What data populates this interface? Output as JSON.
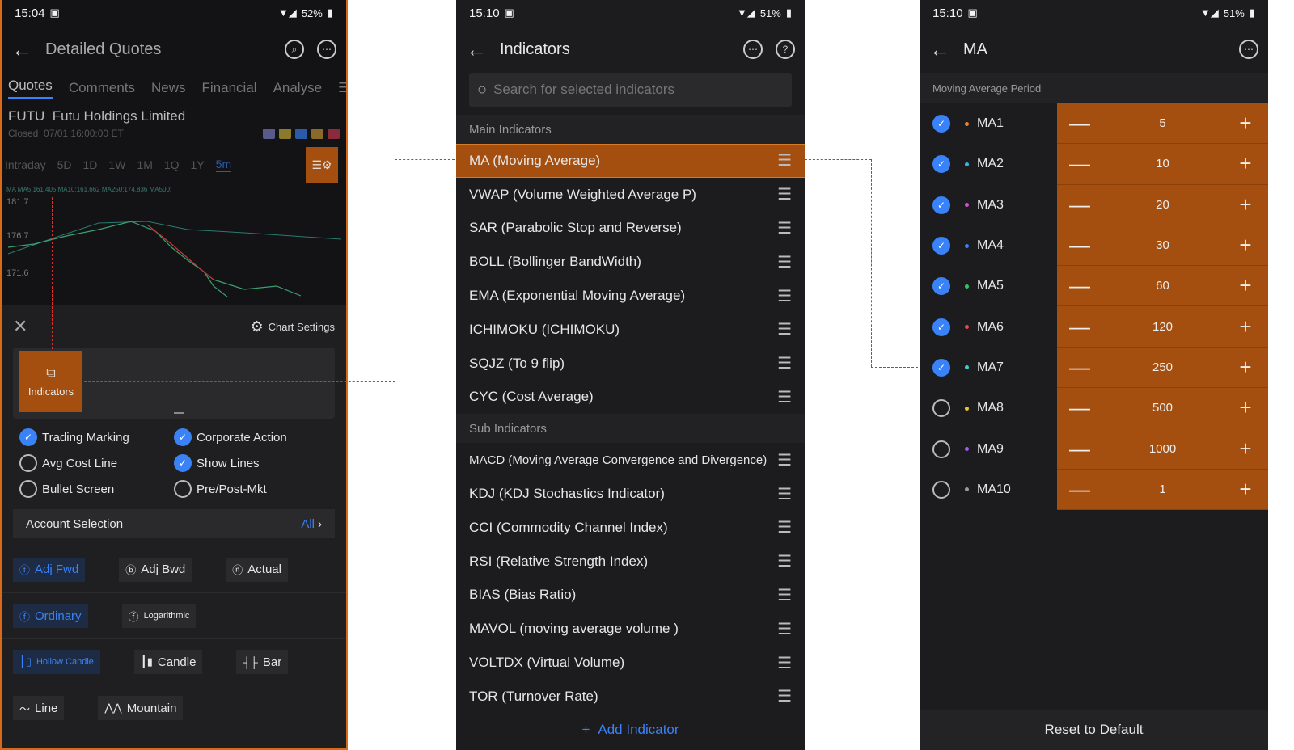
{
  "p1": {
    "status": {
      "time": "15:04",
      "battery": "52%"
    },
    "title": "Detailed Quotes",
    "tabs": [
      "Quotes",
      "Comments",
      "News",
      "Financial",
      "Analyse"
    ],
    "stock": {
      "ticker": "FUTU",
      "name": "Futu Holdings Limited",
      "state": "Closed",
      "time": "07/01 16:00:00 ET"
    },
    "ranges": [
      "Intraday",
      "5D",
      "1D",
      "1W",
      "1M",
      "1Q",
      "1Y",
      "5m"
    ],
    "legend": "MA  MA5:161.405  MA10:161.662  MA250:174.836  MA500:",
    "y": [
      "181.7",
      "176.7",
      "171.6"
    ],
    "chart_settings": "Chart Settings",
    "indicators_label": "Indicators",
    "checks": [
      {
        "label": "Trading Marking",
        "on": true
      },
      {
        "label": "Corporate Action",
        "on": true
      },
      {
        "label": "Avg Cost Line",
        "on": false
      },
      {
        "label": "Show Lines",
        "on": true
      },
      {
        "label": "Bullet Screen",
        "on": false
      },
      {
        "label": "Pre/Post-Mkt",
        "on": false
      }
    ],
    "account": {
      "label": "Account Selection",
      "value": "All"
    },
    "buttons": {
      "adj_fwd": "Adj Fwd",
      "adj_bwd": "Adj Bwd",
      "actual": "Actual",
      "ordinary": "Ordinary",
      "log": "Logarithmic",
      "hollow": "Hollow Candle",
      "candle": "Candle",
      "bar": "Bar",
      "line": "Line",
      "mountain": "Mountain"
    }
  },
  "p2": {
    "status": {
      "time": "15:10",
      "battery": "51%"
    },
    "title": "Indicators",
    "search_placeholder": "Search for selected indicators",
    "main_header": "Main Indicators",
    "main": [
      "MA (Moving Average)",
      "VWAP (Volume Weighted Average P)",
      "SAR (Parabolic Stop and Reverse)",
      "BOLL (Bollinger BandWidth)",
      "EMA (Exponential Moving Average)",
      "ICHIMOKU (ICHIMOKU)",
      "SQJZ (To 9 flip)",
      "CYC (Cost Average)"
    ],
    "sub_header": "Sub Indicators",
    "sub": [
      "MACD (Moving Average Convergence and Divergence)",
      "KDJ (KDJ Stochastics Indicator)",
      "CCI (Commodity Channel Index)",
      "RSI (Relative Strength Index)",
      "BIAS (Bias Ratio)",
      "MAVOL (moving average volume )",
      "VOLTDX (Virtual Volume)",
      "TOR (Turnover Rate)"
    ],
    "add": "Add Indicator"
  },
  "p3": {
    "status": {
      "time": "15:10",
      "battery": "51%"
    },
    "title": "MA",
    "section": "Moving Average Period",
    "rows": [
      {
        "name": "MA1",
        "value": "5",
        "on": true,
        "color": "#e8862a"
      },
      {
        "name": "MA2",
        "value": "10",
        "on": true,
        "color": "#35b5e5"
      },
      {
        "name": "MA3",
        "value": "20",
        "on": true,
        "color": "#d04fd0"
      },
      {
        "name": "MA4",
        "value": "30",
        "on": true,
        "color": "#3a82f7"
      },
      {
        "name": "MA5",
        "value": "60",
        "on": true,
        "color": "#35c26a"
      },
      {
        "name": "MA6",
        "value": "120",
        "on": true,
        "color": "#e84a4a"
      },
      {
        "name": "MA7",
        "value": "250",
        "on": true,
        "color": "#35d0d0"
      },
      {
        "name": "MA8",
        "value": "500",
        "on": false,
        "color": "#e8c52a"
      },
      {
        "name": "MA9",
        "value": "1000",
        "on": false,
        "color": "#a05cf0"
      },
      {
        "name": "MA10",
        "value": "1",
        "on": false,
        "color": "#999999"
      }
    ],
    "reset": "Reset to Default"
  }
}
